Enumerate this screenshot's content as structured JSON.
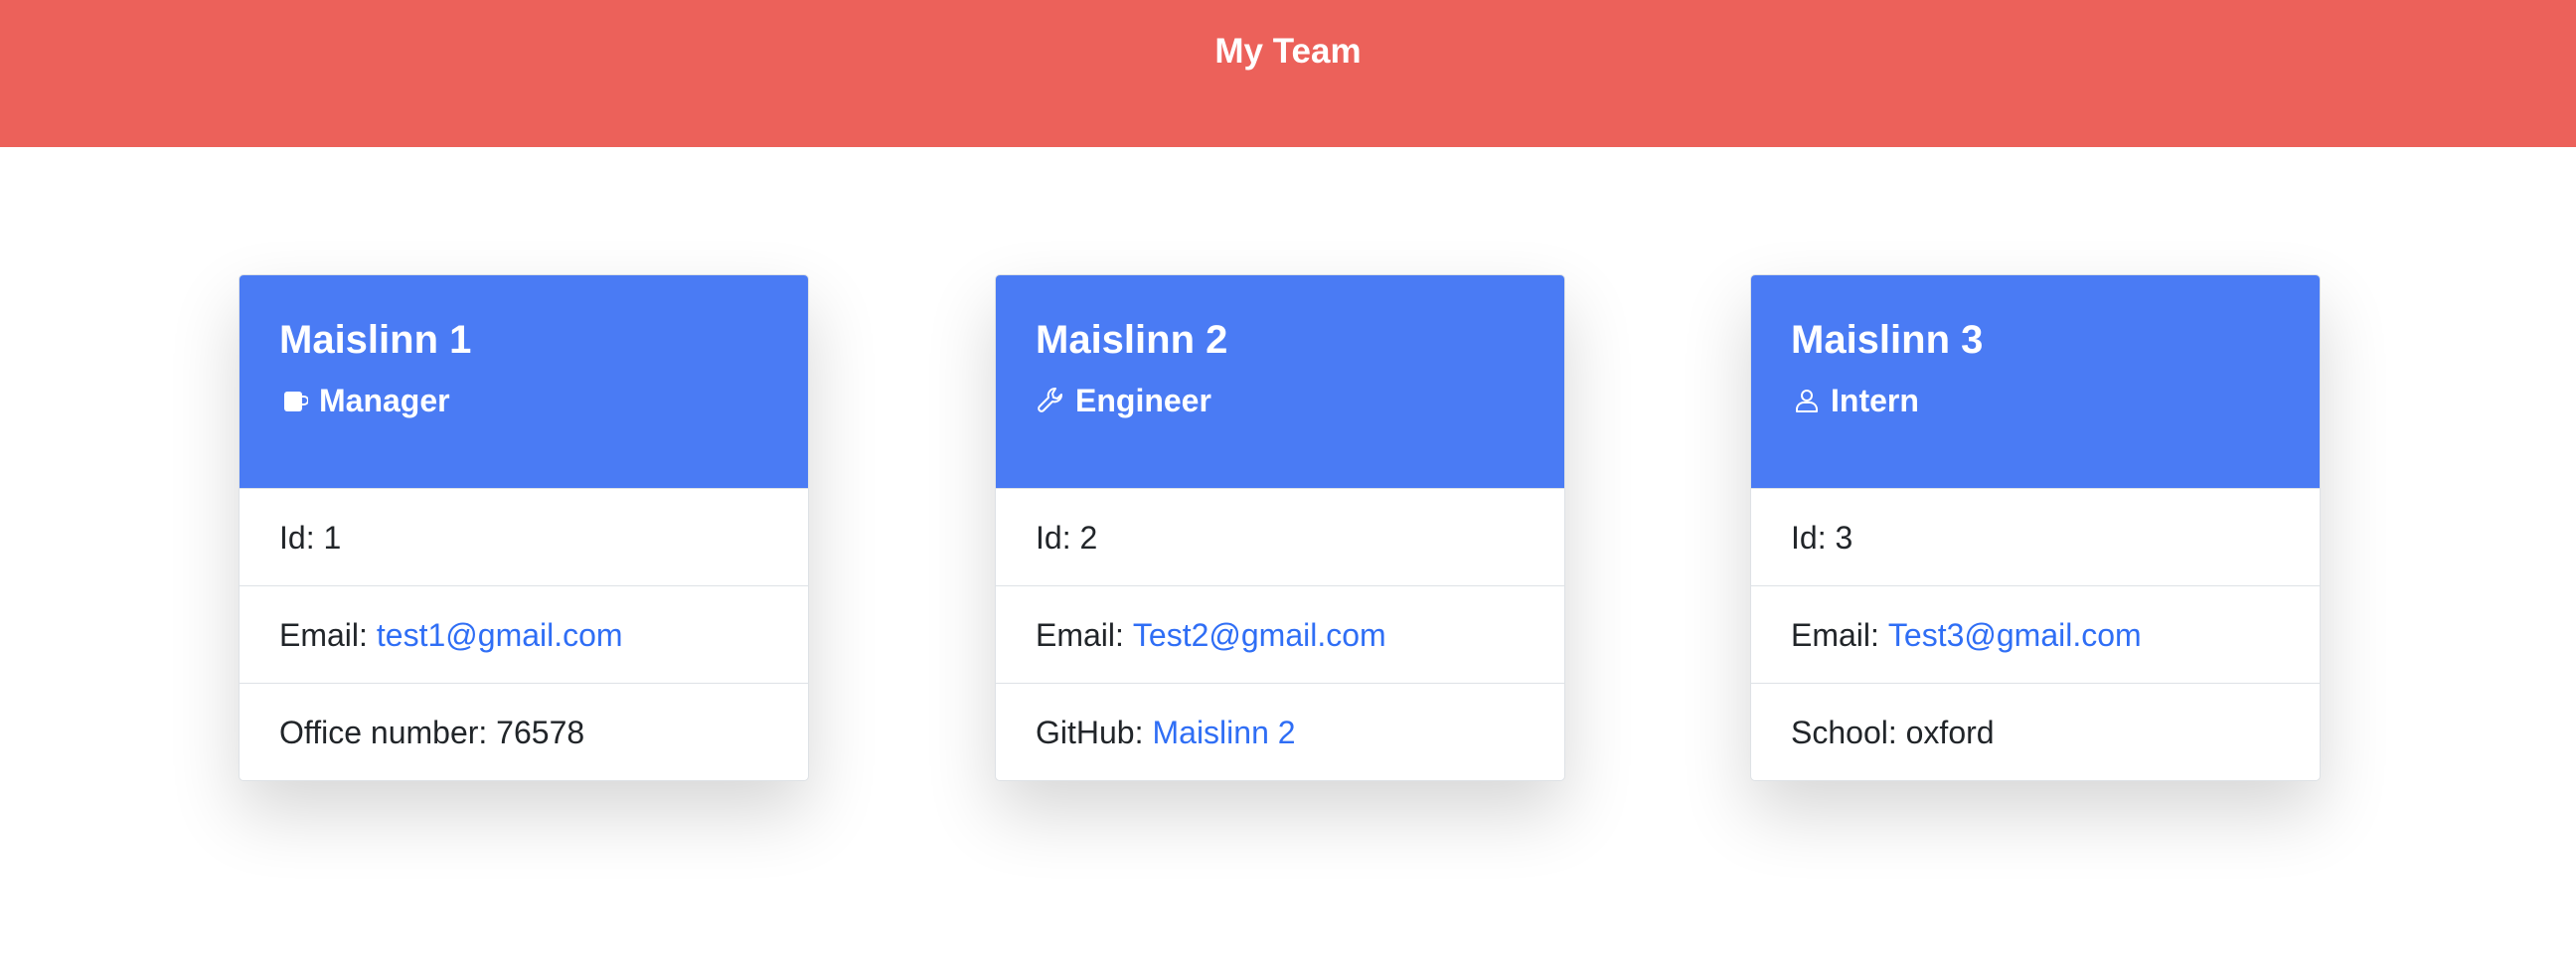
{
  "header": {
    "title": "My Team"
  },
  "employees": [
    {
      "name": "Maislinn 1",
      "role": "Manager",
      "role_icon": "mug-icon",
      "id_label": "Id: 1",
      "email_label": "Email:",
      "email": "test1@gmail.com",
      "extra_label": "Office number: 76578"
    },
    {
      "name": "Maislinn 2",
      "role": "Engineer",
      "role_icon": "wrench-icon",
      "id_label": "Id: 2",
      "email_label": "Email:",
      "email": "Test2@gmail.com",
      "extra_label": "GitHub:",
      "extra_link": "Maislinn 2"
    },
    {
      "name": "Maislinn 3",
      "role": "Intern",
      "role_icon": "person-icon",
      "id_label": "Id: 3",
      "email_label": "Email:",
      "email": "Test3@gmail.com",
      "extra_label": "School: oxford"
    }
  ],
  "colors": {
    "header_bg": "#ec615a",
    "card_header_bg": "#4a7bf4",
    "link": "#2f6ef5"
  }
}
